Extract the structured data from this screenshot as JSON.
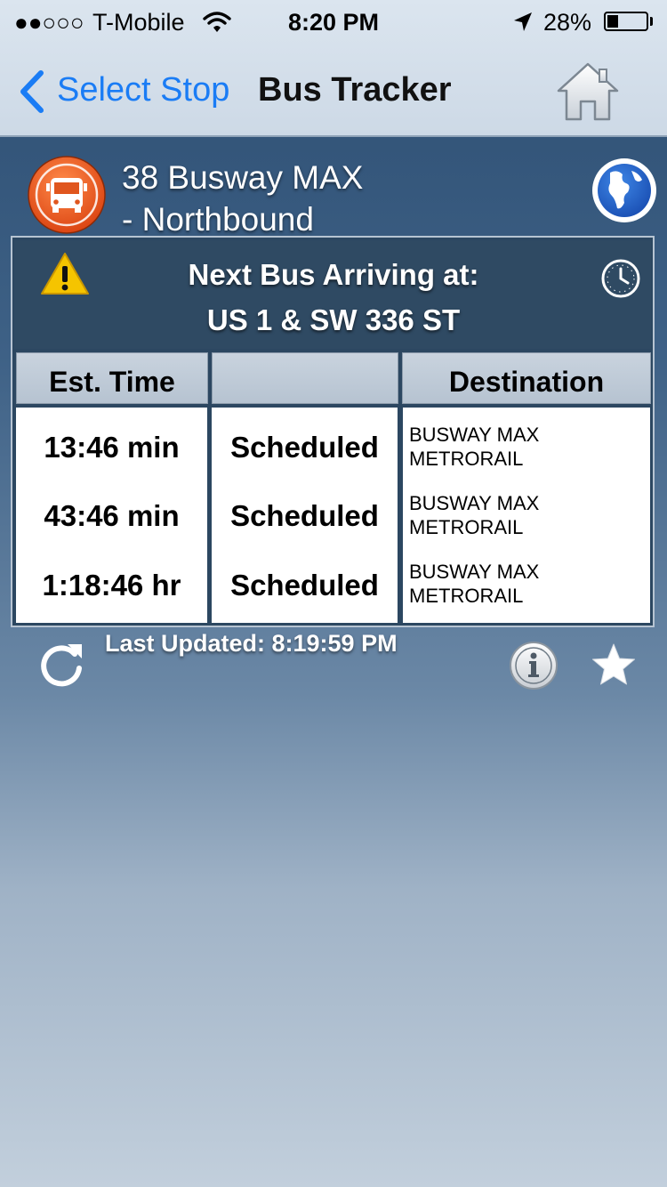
{
  "status_bar": {
    "signal": "●●○○○",
    "carrier": "T-Mobile",
    "time": "8:20 PM",
    "battery_percent": "28%",
    "battery_level": 0.28
  },
  "nav": {
    "back_label": "Select Stop",
    "title": "Bus Tracker"
  },
  "route": {
    "line1": "38 Busway MAX",
    "line2": "- Northbound"
  },
  "next_bus": {
    "heading": "Next Bus Arriving at:",
    "stop": "US 1 & SW 336 ST"
  },
  "table": {
    "headers": [
      "Est. Time",
      "",
      "Destination"
    ],
    "rows": [
      {
        "time": "13:46 min",
        "status": "Scheduled",
        "dest_line1": "BUSWAY MAX",
        "dest_line2": "METRORAIL"
      },
      {
        "time": "43:46 min",
        "status": "Scheduled",
        "dest_line1": "BUSWAY MAX",
        "dest_line2": "METRORAIL"
      },
      {
        "time": "1:18:46 hr",
        "status": "Scheduled",
        "dest_line1": "BUSWAY MAX",
        "dest_line2": "METRORAIL"
      }
    ]
  },
  "footer": {
    "last_updated": "Last Updated: 8:19:59 PM"
  },
  "colors": {
    "accent": "#1a7cf5",
    "route_icon": "#e8511a",
    "warning": "#f5c400"
  },
  "icons": {
    "home": "home-icon",
    "route": "bus-icon",
    "globe": "globe-icon",
    "warning": "warning-icon",
    "clock": "clock-icon",
    "refresh": "refresh-icon",
    "info": "info-icon",
    "favorite": "star-icon"
  }
}
